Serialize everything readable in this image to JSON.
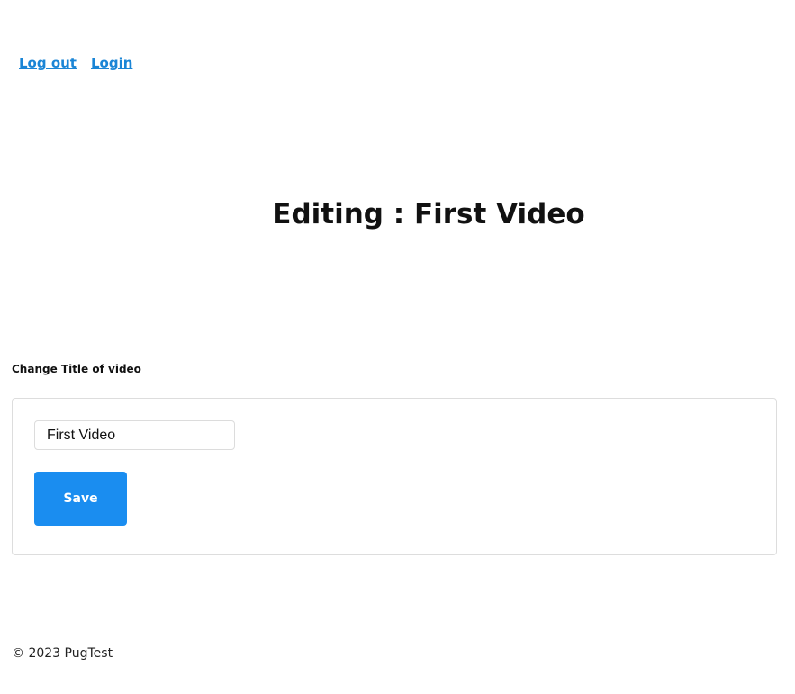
{
  "nav": {
    "logout_label": "Log out",
    "login_label": "Login"
  },
  "page": {
    "title": "Editing : First Video"
  },
  "form": {
    "section_label": "Change Title of video",
    "title_input_value": "First Video",
    "save_label": "Save"
  },
  "footer": {
    "text": "© 2023 PugTest"
  },
  "colors": {
    "link": "#1a85d6",
    "primary_button": "#1a8df0",
    "card_border": "#dddddd"
  }
}
